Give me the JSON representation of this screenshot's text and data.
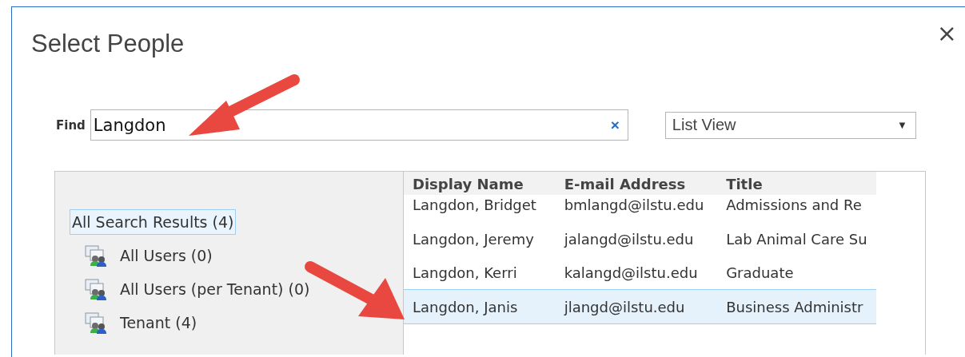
{
  "dialog": {
    "title": "Select People",
    "close": "×"
  },
  "find": {
    "label": "Find",
    "value": "Langdon",
    "clear": "×"
  },
  "view": {
    "value": "List View",
    "caret": "▼"
  },
  "tree": [
    {
      "label": "All Search Results (4)",
      "selected": true,
      "children": [
        {
          "label": "All Users (0)",
          "selected": false
        },
        {
          "label": "All Users (per Tenant) (0)",
          "selected": false
        },
        {
          "label": "Tenant (4)",
          "selected": false
        }
      ]
    }
  ],
  "table": {
    "columns": [
      "Display Name",
      "E-mail Address",
      "Title"
    ],
    "rows": [
      {
        "cells": [
          "Langdon, Bridget",
          "bmlangd@ilstu.edu",
          "Admissions and Re"
        ],
        "selected": false
      },
      {
        "cells": [
          "Langdon, Jeremy",
          "jalangd@ilstu.edu",
          "Lab Animal Care Su"
        ],
        "selected": false
      },
      {
        "cells": [
          "Langdon, Kerri",
          "kalangd@ilstu.edu",
          "Graduate"
        ],
        "selected": false
      },
      {
        "cells": [
          "Langdon, Janis",
          "jlangd@ilstu.edu",
          "Business Administr"
        ],
        "selected": true
      }
    ]
  }
}
